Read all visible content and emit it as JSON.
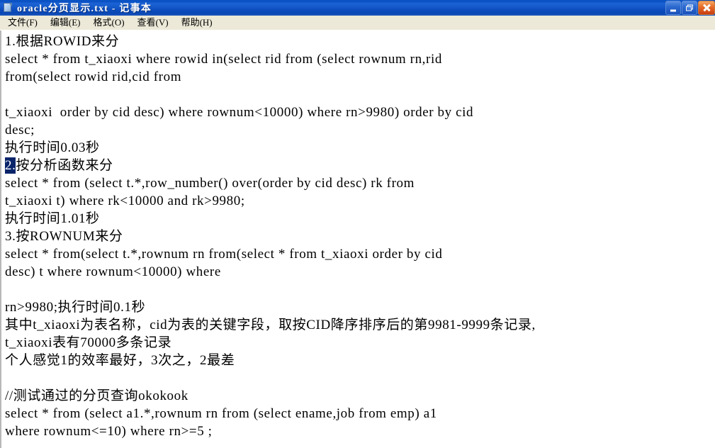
{
  "window": {
    "title": "oracle分页显示.txt - 记事本",
    "icon": "notepad-document-icon",
    "colors": {
      "titlebar_blue": "#0a4fc0",
      "menubar": "#ece9d8",
      "selection": "#0a246a",
      "close_button": "#e8702a"
    },
    "buttons": {
      "minimize": "minimize",
      "restore": "restore",
      "close": "close"
    }
  },
  "menubar": {
    "items": [
      {
        "label": "文件(F)"
      },
      {
        "label": "编辑(E)"
      },
      {
        "label": "格式(O)"
      },
      {
        "label": "查看(V)"
      },
      {
        "label": "帮助(H)"
      }
    ]
  },
  "document": {
    "lines": [
      "1.根据ROWID来分",
      "select * from t_xiaoxi where rowid in(select rid from (select rownum rn,rid",
      "from(select rowid rid,cid from",
      "",
      "t_xiaoxi  order by cid desc) where rownum<10000) where rn>9980) order by cid",
      "desc;",
      "执行时间0.03秒",
      "__SELECTION_LINE__",
      "select * from (select t.*,row_number() over(order by cid desc) rk from",
      "t_xiaoxi t) where rk<10000 and rk>9980;",
      "执行时间1.01秒",
      "3.按ROWNUM来分",
      "select * from(select t.*,rownum rn from(select * from t_xiaoxi order by cid",
      "desc) t where rownum<10000) where",
      "",
      "rn>9980;执行时间0.1秒",
      "其中t_xiaoxi为表名称，cid为表的关键字段，取按CID降序排序后的第9981-9999条记录,",
      "t_xiaoxi表有70000多条记录",
      "个人感觉1的效率最好，3次之，2最差",
      "",
      "//测试通过的分页查询okokook",
      "select * from (select a1.*,rownum rn from (select ename,job from emp) a1",
      "where rownum<=10) where rn>=5 ;"
    ],
    "selection": {
      "selected_text": "2.",
      "rest_of_line": "按分析函数来分"
    }
  }
}
